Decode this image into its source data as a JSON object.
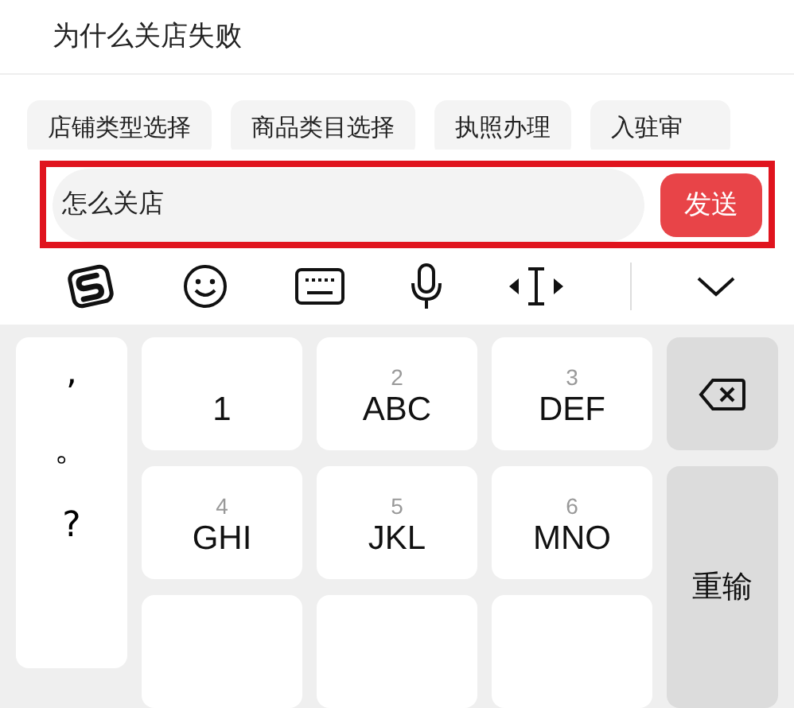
{
  "message": {
    "text": "为什么关店失败"
  },
  "chips": [
    {
      "label": "店铺类型选择"
    },
    {
      "label": "商品类目选择"
    },
    {
      "label": "执照办理"
    },
    {
      "label": "入驻审"
    }
  ],
  "composer": {
    "value": "怎么关店",
    "send_label": "发送"
  },
  "toolbar": [
    {
      "kind": "sogou"
    },
    {
      "kind": "emoji"
    },
    {
      "kind": "keyboard"
    },
    {
      "kind": "mic"
    },
    {
      "kind": "cursor"
    },
    {
      "kind": "collapse"
    }
  ],
  "keyboard": {
    "punctuation": [
      ",",
      "。",
      "?"
    ],
    "keys": [
      {
        "kind": "full",
        "letters": "1"
      },
      {
        "kind": "full",
        "digit": "2",
        "letters": "ABC"
      },
      {
        "kind": "full",
        "digit": "3",
        "letters": "DEF"
      },
      {
        "kind": "full",
        "digit": "4",
        "letters": "GHI"
      },
      {
        "kind": "full",
        "digit": "5",
        "letters": "JKL"
      },
      {
        "kind": "full",
        "digit": "6",
        "letters": "MNO"
      },
      {
        "kind": "cut_off"
      },
      {
        "kind": "cut_off"
      },
      {
        "kind": "cut_off"
      }
    ],
    "reset_label": "重输"
  }
}
